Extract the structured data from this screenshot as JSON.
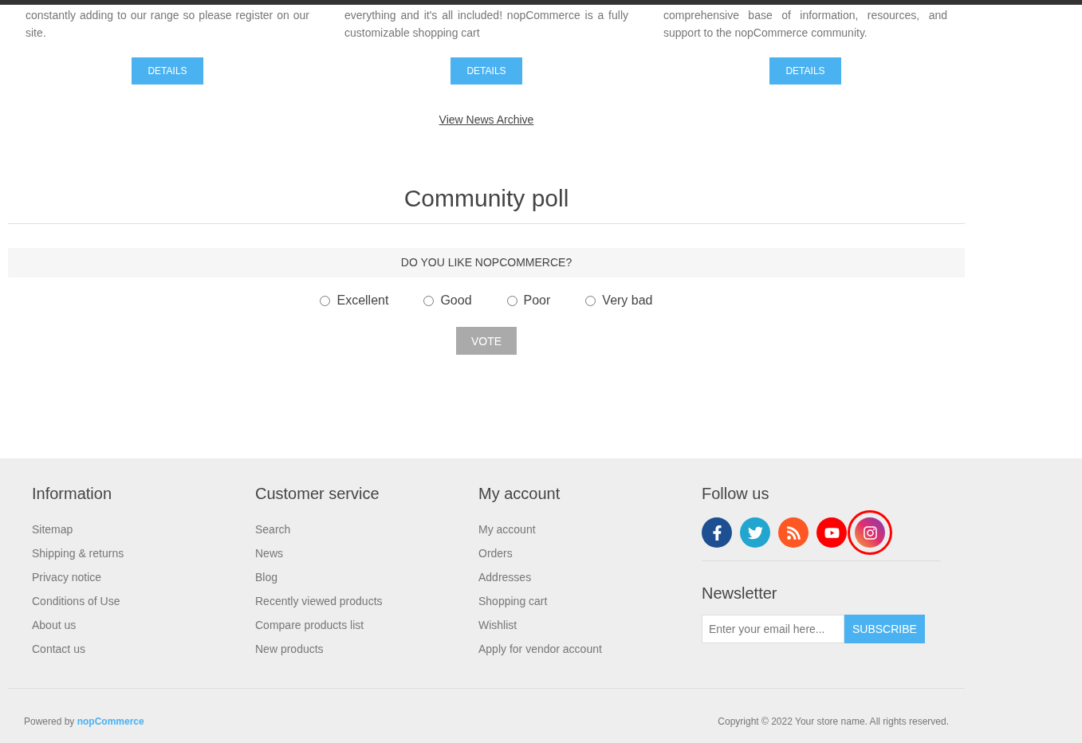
{
  "news": [
    {
      "text": "constantly adding to our range so please register on our site.",
      "button": "DETAILS"
    },
    {
      "text": "everything and it's all included! nopCommerce is a fully customizable shopping cart",
      "button": "DETAILS"
    },
    {
      "text": "comprehensive base of information, resources, and support to the nopCommerce community.",
      "button": "DETAILS"
    }
  ],
  "news_archive_link": "View News Archive",
  "poll": {
    "title": "Community poll",
    "question": "DO YOU LIKE NOPCOMMERCE?",
    "options": [
      {
        "label": "Excellent",
        "selected": false
      },
      {
        "label": "Good",
        "selected": false
      },
      {
        "label": "Poor",
        "selected": false
      },
      {
        "label": "Very bad",
        "selected": false
      }
    ],
    "vote_button": "VOTE"
  },
  "footer": {
    "columns": [
      {
        "title": "Information",
        "links": [
          "Sitemap",
          "Shipping & returns",
          "Privacy notice",
          "Conditions of Use",
          "About us",
          "Contact us"
        ]
      },
      {
        "title": "Customer service",
        "links": [
          "Search",
          "News",
          "Blog",
          "Recently viewed products",
          "Compare products list",
          "New products"
        ]
      },
      {
        "title": "My account",
        "links": [
          "My account",
          "Orders",
          "Addresses",
          "Shopping cart",
          "Wishlist",
          "Apply for vendor account"
        ]
      }
    ],
    "follow": {
      "title": "Follow us",
      "social": [
        {
          "kind": "facebook",
          "highlighted": false
        },
        {
          "kind": "twitter",
          "highlighted": false
        },
        {
          "kind": "rss",
          "highlighted": false
        },
        {
          "kind": "youtube",
          "highlighted": false
        },
        {
          "kind": "instagram",
          "highlighted": true
        }
      ]
    },
    "newsletter": {
      "title": "Newsletter",
      "placeholder": "Enter your email here...",
      "button": "SUBSCRIBE"
    },
    "powered_by": "Powered by **nopCommerce**",
    "copyright": "Copyright © 2022 Your store name. All rights reserved."
  }
}
